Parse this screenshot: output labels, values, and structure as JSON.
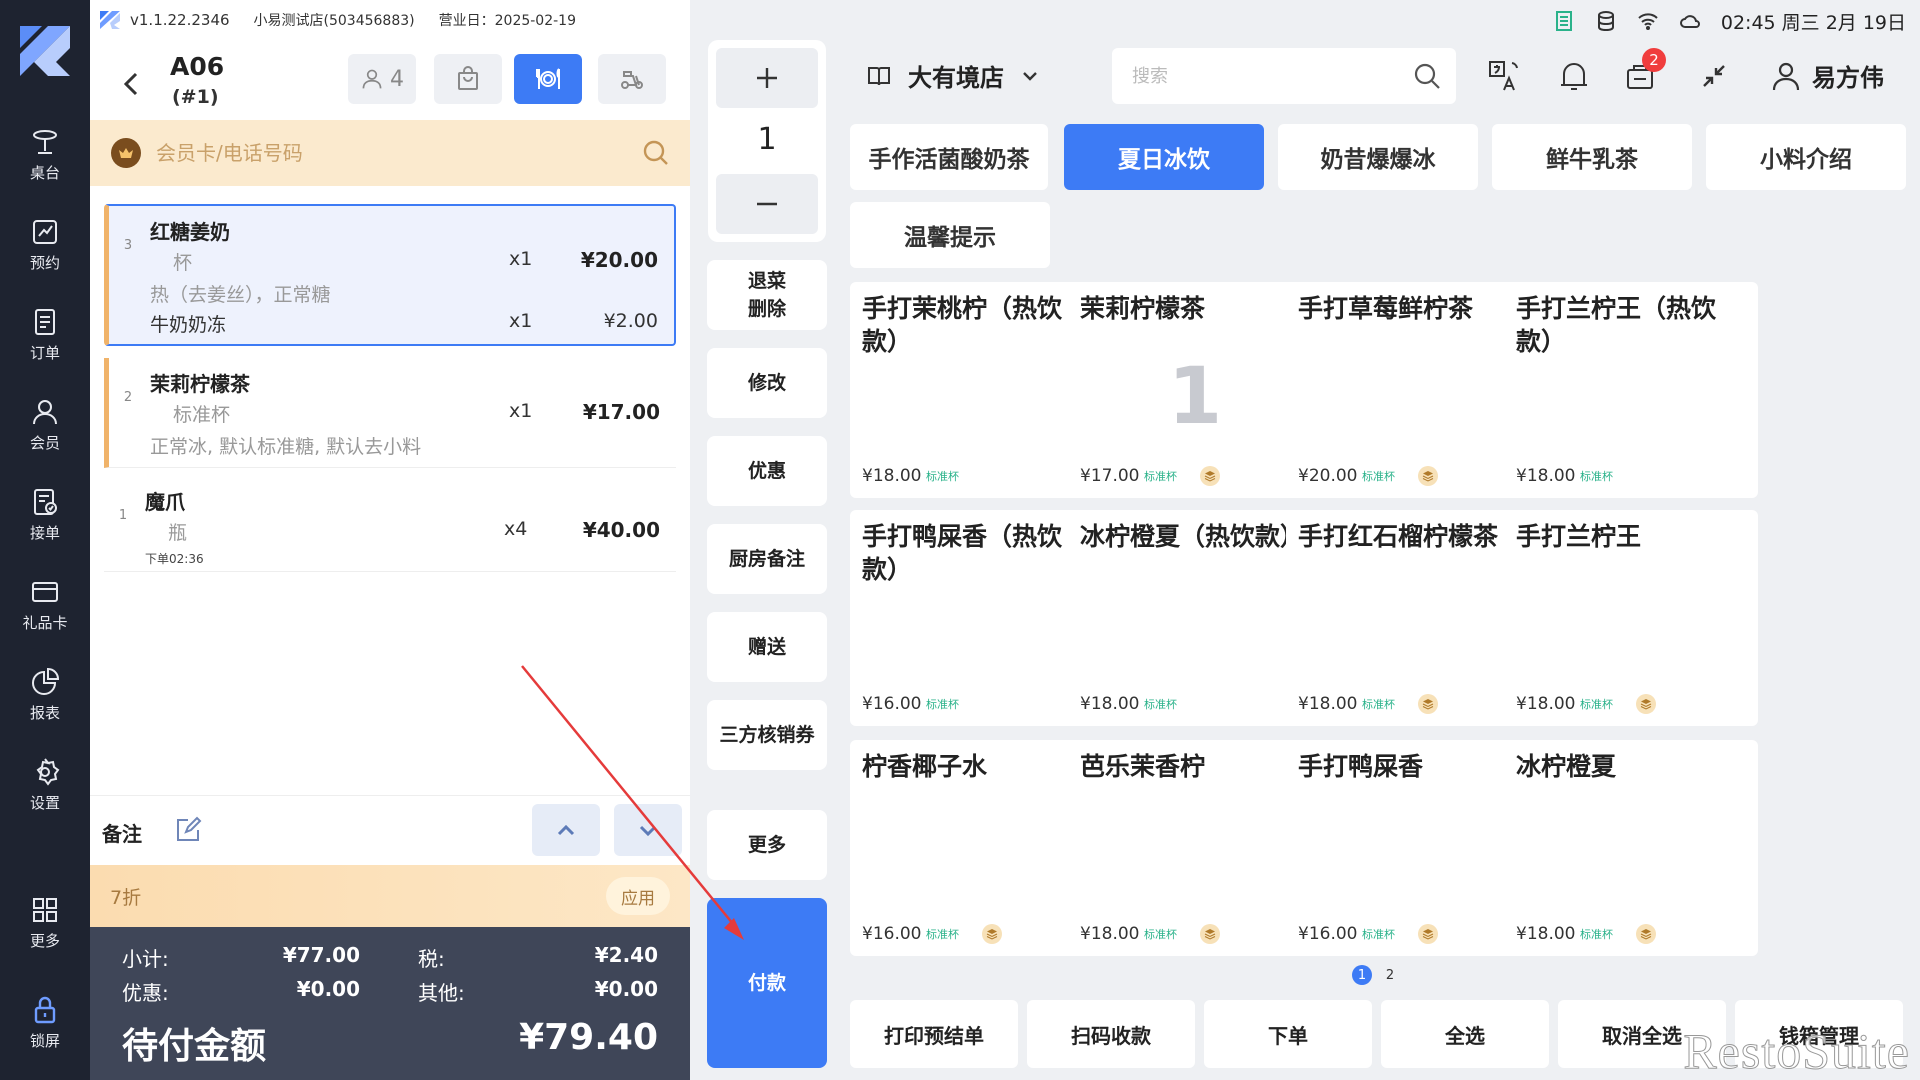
{
  "app": {
    "version": "v1.1.22.2346",
    "store_info": "小易测试店(503456883)",
    "business_date": "营业日：2025-02-19"
  },
  "nav": {
    "items": [
      {
        "label": "桌台",
        "icon": "table-icon"
      },
      {
        "label": "预约",
        "icon": "reservation-icon"
      },
      {
        "label": "订单",
        "icon": "order-icon"
      },
      {
        "label": "会员",
        "icon": "member-icon"
      },
      {
        "label": "接单",
        "icon": "accept-order-icon"
      },
      {
        "label": "礼品卡",
        "icon": "gift-card-icon"
      },
      {
        "label": "报表",
        "icon": "report-icon"
      },
      {
        "label": "设置",
        "icon": "settings-icon"
      }
    ],
    "more": "更多",
    "lock": "锁屏"
  },
  "order": {
    "table": "A06",
    "table_sub": "(#1)",
    "guests": "4",
    "member_placeholder": "会员卡/电话号码",
    "items": [
      {
        "index": "3",
        "name": "红糖姜奶",
        "unit": "杯",
        "qty": "x1",
        "price": "¥20.00",
        "note": "热（去姜丝），正常糖",
        "sub_name": "牛奶奶冻",
        "sub_qty": "x1",
        "sub_price": "¥2.00"
      },
      {
        "index": "2",
        "name": "茉莉柠檬茶",
        "unit": "标准杯",
        "qty": "x1",
        "price": "¥17.00",
        "note": "正常冰, 默认标准糖, 默认去小料"
      },
      {
        "index": "1",
        "name": "魔爪",
        "unit": "瓶",
        "qty": "x4",
        "price": "¥40.00",
        "note": "下单02:36"
      }
    ],
    "remark_label": "备注",
    "discount_text": "7折",
    "apply_label": "应用",
    "totals": {
      "subtotal_label": "小计:",
      "subtotal": "¥77.00",
      "tax_label": "税:",
      "tax": "¥2.40",
      "discount_label": "优惠:",
      "discount": "¥0.00",
      "other_label": "其他:",
      "other": "¥0.00",
      "due_label": "待付金额",
      "due": "¥79.40"
    }
  },
  "actions": {
    "quantity": "1",
    "buttons": [
      "退菜\n删除",
      "修改",
      "优惠",
      "厨房备注",
      "赠送",
      "三方核销券",
      "更多"
    ],
    "pay": "付款"
  },
  "status": {
    "time": "02:45 周三 2月 19日"
  },
  "header": {
    "store": "大有境店",
    "search_placeholder": "搜索",
    "notification_badge": "2",
    "user": "易方伟"
  },
  "categories": [
    "手作活菌酸奶茶",
    "夏日冰饮",
    "奶昔爆爆冰",
    "鲜牛乳茶",
    "小料介绍",
    "温馨提示"
  ],
  "active_category": 1,
  "products": [
    {
      "name": "手打茉桃柠（热饮款）",
      "price": "¥18.00",
      "tag": "标准杯",
      "icon": false,
      "qty": ""
    },
    {
      "name": "茉莉柠檬茶",
      "price": "¥17.00",
      "tag": "标准杯",
      "icon": true,
      "qty": "1"
    },
    {
      "name": "手打草莓鲜柠茶",
      "price": "¥20.00",
      "tag": "标准杯",
      "icon": true,
      "qty": ""
    },
    {
      "name": "手打兰柠王（热饮款）",
      "price": "¥18.00",
      "tag": "标准杯",
      "icon": false,
      "qty": ""
    },
    {
      "name": "手打鸭屎香（热饮款）",
      "price": "¥16.00",
      "tag": "标准杯",
      "icon": false,
      "qty": ""
    },
    {
      "name": "冰柠橙夏（热饮款）",
      "price": "¥18.00",
      "tag": "标准杯",
      "icon": false,
      "qty": ""
    },
    {
      "name": "手打红石榴柠檬茶",
      "price": "¥18.00",
      "tag": "标准杯",
      "icon": true,
      "qty": ""
    },
    {
      "name": "手打兰柠王",
      "price": "¥18.00",
      "tag": "标准杯",
      "icon": true,
      "qty": ""
    },
    {
      "name": "柠香椰子水",
      "price": "¥16.00",
      "tag": "标准杯",
      "icon": true,
      "qty": ""
    },
    {
      "name": "芭乐茉香柠",
      "price": "¥18.00",
      "tag": "标准杯",
      "icon": true,
      "qty": ""
    },
    {
      "name": "手打鸭屎香",
      "price": "¥16.00",
      "tag": "标准杯",
      "icon": true,
      "qty": ""
    },
    {
      "name": "冰柠橙夏",
      "price": "¥18.00",
      "tag": "标准杯",
      "icon": true,
      "qty": ""
    }
  ],
  "pages": [
    "1",
    "2"
  ],
  "bottom_buttons": [
    "打印预结单",
    "扫码收款",
    "下单",
    "全选",
    "取消全选",
    "钱箱管理"
  ],
  "watermark": "RestoSuite",
  "colors": {
    "primary": "#3d7bf5",
    "nav_bg": "#1e2330",
    "totals_bg": "#3f4658",
    "member_bar": "#fbeace",
    "badge": "#f03d3d",
    "tag_green": "#2ab28a"
  }
}
